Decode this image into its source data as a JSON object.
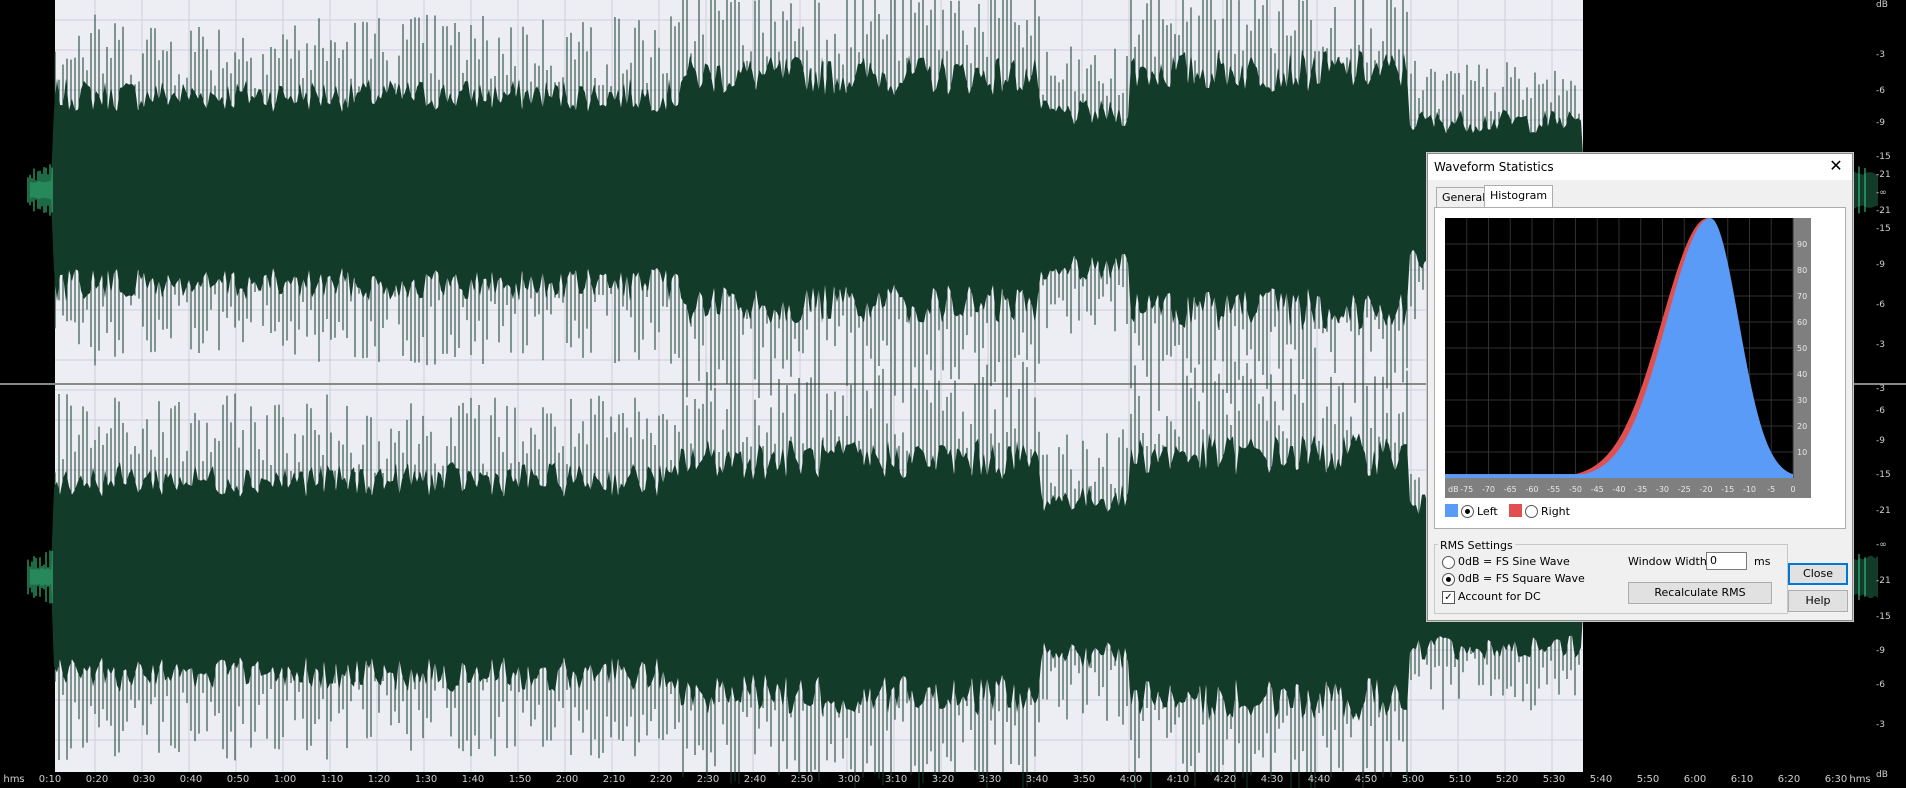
{
  "editor": {
    "colors": {
      "selection_bg": "#ededf4",
      "outside_bg": "#000000",
      "wave_selected": "#133b2a",
      "wave_unselected": "#3bd58e",
      "grid": "#cfcfdb"
    },
    "db_scale_labels": [
      "dB",
      "-3",
      "-6",
      "-9",
      "-15",
      "-21",
      "-∞",
      "-21",
      "-15",
      "-9",
      "-6",
      "-3",
      "-3",
      "-6",
      "-9",
      "-15",
      "-21",
      "-∞",
      "-21",
      "-15",
      "-9",
      "-6",
      "-3",
      "dB"
    ],
    "time_labels": [
      "hms",
      "0:10",
      "0:20",
      "0:30",
      "0:40",
      "0:50",
      "1:00",
      "1:10",
      "1:20",
      "1:30",
      "1:40",
      "1:50",
      "2:00",
      "2:10",
      "2:20",
      "2:30",
      "2:40",
      "2:50",
      "3:00",
      "3:10",
      "3:20",
      "3:30",
      "3:40",
      "3:50",
      "4:00",
      "4:10",
      "4:20",
      "4:30",
      "4:40",
      "4:50",
      "5:00",
      "5:10",
      "5:20",
      "5:30",
      "5:40",
      "5:50",
      "6:00",
      "6:10",
      "6:20",
      "6:30",
      "hms"
    ]
  },
  "dialog": {
    "title": "Waveform Statistics",
    "close_glyph": "✕",
    "tabs": [
      {
        "label": "General",
        "active": false
      },
      {
        "label": "Histogram",
        "active": true
      }
    ],
    "histogram": {
      "x_ticks": [
        "dB",
        "-75",
        "-70",
        "-65",
        "-60",
        "-55",
        "-50",
        "-45",
        "-40",
        "-35",
        "-30",
        "-25",
        "-20",
        "-15",
        "-10",
        "-5",
        "0"
      ],
      "y_ticks": [
        "90",
        "80",
        "70",
        "60",
        "50",
        "40",
        "30",
        "20",
        "10"
      ],
      "peak_db": -19,
      "peak_percent": 100,
      "left_color": "#5b9bf8",
      "right_color": "#e05050"
    },
    "legend": {
      "left_label": "Left",
      "right_label": "Right",
      "left_selected": true
    },
    "rms": {
      "group_label": "RMS Settings",
      "sine_label": "0dB = FS Sine Wave",
      "square_label": "0dB = FS Square Wave",
      "square_selected": true,
      "dc_label": "Account for DC",
      "dc_checked": true,
      "window_width_label": "Window Width:",
      "window_width_value": "0",
      "window_width_unit": "ms",
      "recalculate_label": "Recalculate RMS"
    },
    "buttons": {
      "close_label": "Close",
      "help_label": "Help"
    }
  }
}
